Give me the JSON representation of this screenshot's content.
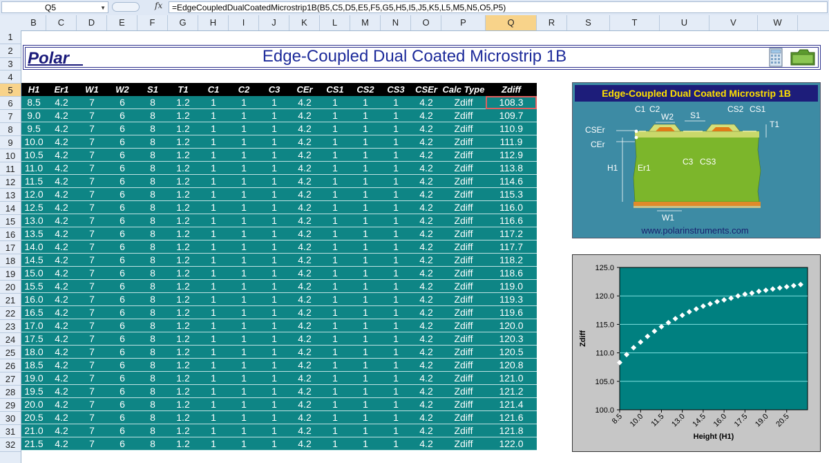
{
  "formula_bar": {
    "name_box": "Q5",
    "fx_label": "fx",
    "formula": "=EdgeCoupledDualCoatedMicrostrip1B(B5,C5,D5,E5,F5,G5,H5,I5,J5,K5,L5,M5,N5,O5,P5)"
  },
  "columns": [
    "B",
    "C",
    "D",
    "E",
    "F",
    "G",
    "H",
    "I",
    "J",
    "K",
    "L",
    "M",
    "N",
    "O",
    "P",
    "Q",
    "R",
    "S",
    "T",
    "U",
    "V",
    "W"
  ],
  "rows": [
    "1",
    "2",
    "3",
    "4",
    "5",
    "6",
    "7",
    "8",
    "9",
    "10",
    "11",
    "12",
    "13",
    "14",
    "15",
    "16",
    "17",
    "18",
    "19",
    "20",
    "21",
    "22",
    "23",
    "24",
    "25",
    "26",
    "27",
    "28",
    "29",
    "30",
    "31",
    "32"
  ],
  "title_row": {
    "logo_text": "Polar",
    "title": "Edge-Coupled Dual Coated Microstrip 1B"
  },
  "table": {
    "headers": [
      "H1",
      "Er1",
      "W1",
      "W2",
      "S1",
      "T1",
      "C1",
      "C2",
      "C3",
      "CEr",
      "CS1",
      "CS2",
      "CS3",
      "CSEr",
      "Calc Type",
      "Zdiff"
    ],
    "rows": [
      [
        "8.5",
        "4.2",
        "7",
        "6",
        "8",
        "1.2",
        "1",
        "1",
        "1",
        "4.2",
        "1",
        "1",
        "1",
        "4.2",
        "Zdiff",
        "108.3"
      ],
      [
        "9.0",
        "4.2",
        "7",
        "6",
        "8",
        "1.2",
        "1",
        "1",
        "1",
        "4.2",
        "1",
        "1",
        "1",
        "4.2",
        "Zdiff",
        "109.7"
      ],
      [
        "9.5",
        "4.2",
        "7",
        "6",
        "8",
        "1.2",
        "1",
        "1",
        "1",
        "4.2",
        "1",
        "1",
        "1",
        "4.2",
        "Zdiff",
        "110.9"
      ],
      [
        "10.0",
        "4.2",
        "7",
        "6",
        "8",
        "1.2",
        "1",
        "1",
        "1",
        "4.2",
        "1",
        "1",
        "1",
        "4.2",
        "Zdiff",
        "111.9"
      ],
      [
        "10.5",
        "4.2",
        "7",
        "6",
        "8",
        "1.2",
        "1",
        "1",
        "1",
        "4.2",
        "1",
        "1",
        "1",
        "4.2",
        "Zdiff",
        "112.9"
      ],
      [
        "11.0",
        "4.2",
        "7",
        "6",
        "8",
        "1.2",
        "1",
        "1",
        "1",
        "4.2",
        "1",
        "1",
        "1",
        "4.2",
        "Zdiff",
        "113.8"
      ],
      [
        "11.5",
        "4.2",
        "7",
        "6",
        "8",
        "1.2",
        "1",
        "1",
        "1",
        "4.2",
        "1",
        "1",
        "1",
        "4.2",
        "Zdiff",
        "114.6"
      ],
      [
        "12.0",
        "4.2",
        "7",
        "6",
        "8",
        "1.2",
        "1",
        "1",
        "1",
        "4.2",
        "1",
        "1",
        "1",
        "4.2",
        "Zdiff",
        "115.3"
      ],
      [
        "12.5",
        "4.2",
        "7",
        "6",
        "8",
        "1.2",
        "1",
        "1",
        "1",
        "4.2",
        "1",
        "1",
        "1",
        "4.2",
        "Zdiff",
        "116.0"
      ],
      [
        "13.0",
        "4.2",
        "7",
        "6",
        "8",
        "1.2",
        "1",
        "1",
        "1",
        "4.2",
        "1",
        "1",
        "1",
        "4.2",
        "Zdiff",
        "116.6"
      ],
      [
        "13.5",
        "4.2",
        "7",
        "6",
        "8",
        "1.2",
        "1",
        "1",
        "1",
        "4.2",
        "1",
        "1",
        "1",
        "4.2",
        "Zdiff",
        "117.2"
      ],
      [
        "14.0",
        "4.2",
        "7",
        "6",
        "8",
        "1.2",
        "1",
        "1",
        "1",
        "4.2",
        "1",
        "1",
        "1",
        "4.2",
        "Zdiff",
        "117.7"
      ],
      [
        "14.5",
        "4.2",
        "7",
        "6",
        "8",
        "1.2",
        "1",
        "1",
        "1",
        "4.2",
        "1",
        "1",
        "1",
        "4.2",
        "Zdiff",
        "118.2"
      ],
      [
        "15.0",
        "4.2",
        "7",
        "6",
        "8",
        "1.2",
        "1",
        "1",
        "1",
        "4.2",
        "1",
        "1",
        "1",
        "4.2",
        "Zdiff",
        "118.6"
      ],
      [
        "15.5",
        "4.2",
        "7",
        "6",
        "8",
        "1.2",
        "1",
        "1",
        "1",
        "4.2",
        "1",
        "1",
        "1",
        "4.2",
        "Zdiff",
        "119.0"
      ],
      [
        "16.0",
        "4.2",
        "7",
        "6",
        "8",
        "1.2",
        "1",
        "1",
        "1",
        "4.2",
        "1",
        "1",
        "1",
        "4.2",
        "Zdiff",
        "119.3"
      ],
      [
        "16.5",
        "4.2",
        "7",
        "6",
        "8",
        "1.2",
        "1",
        "1",
        "1",
        "4.2",
        "1",
        "1",
        "1",
        "4.2",
        "Zdiff",
        "119.6"
      ],
      [
        "17.0",
        "4.2",
        "7",
        "6",
        "8",
        "1.2",
        "1",
        "1",
        "1",
        "4.2",
        "1",
        "1",
        "1",
        "4.2",
        "Zdiff",
        "120.0"
      ],
      [
        "17.5",
        "4.2",
        "7",
        "6",
        "8",
        "1.2",
        "1",
        "1",
        "1",
        "4.2",
        "1",
        "1",
        "1",
        "4.2",
        "Zdiff",
        "120.3"
      ],
      [
        "18.0",
        "4.2",
        "7",
        "6",
        "8",
        "1.2",
        "1",
        "1",
        "1",
        "4.2",
        "1",
        "1",
        "1",
        "4.2",
        "Zdiff",
        "120.5"
      ],
      [
        "18.5",
        "4.2",
        "7",
        "6",
        "8",
        "1.2",
        "1",
        "1",
        "1",
        "4.2",
        "1",
        "1",
        "1",
        "4.2",
        "Zdiff",
        "120.8"
      ],
      [
        "19.0",
        "4.2",
        "7",
        "6",
        "8",
        "1.2",
        "1",
        "1",
        "1",
        "4.2",
        "1",
        "1",
        "1",
        "4.2",
        "Zdiff",
        "121.0"
      ],
      [
        "19.5",
        "4.2",
        "7",
        "6",
        "8",
        "1.2",
        "1",
        "1",
        "1",
        "4.2",
        "1",
        "1",
        "1",
        "4.2",
        "Zdiff",
        "121.2"
      ],
      [
        "20.0",
        "4.2",
        "7",
        "6",
        "8",
        "1.2",
        "1",
        "1",
        "1",
        "4.2",
        "1",
        "1",
        "1",
        "4.2",
        "Zdiff",
        "121.4"
      ],
      [
        "20.5",
        "4.2",
        "7",
        "6",
        "8",
        "1.2",
        "1",
        "1",
        "1",
        "4.2",
        "1",
        "1",
        "1",
        "4.2",
        "Zdiff",
        "121.6"
      ],
      [
        "21.0",
        "4.2",
        "7",
        "6",
        "8",
        "1.2",
        "1",
        "1",
        "1",
        "4.2",
        "1",
        "1",
        "1",
        "4.2",
        "Zdiff",
        "121.8"
      ],
      [
        "21.5",
        "4.2",
        "7",
        "6",
        "8",
        "1.2",
        "1",
        "1",
        "1",
        "4.2",
        "1",
        "1",
        "1",
        "4.2",
        "Zdiff",
        "122.0"
      ]
    ]
  },
  "diagram": {
    "title": "Edge-Coupled Dual Coated Microstrip 1B",
    "labels": [
      "C1",
      "C2",
      "W2",
      "S1",
      "CS2",
      "CS1",
      "T1",
      "CSEr",
      "CEr",
      "H1",
      "Er1",
      "C3",
      "CS3",
      "W1"
    ],
    "url": "www.polarinstruments.com"
  },
  "chart_data": {
    "type": "scatter",
    "title": "",
    "xlabel": "Height (H1)",
    "ylabel": "Zdiff",
    "x": [
      8.5,
      9.0,
      9.5,
      10.0,
      10.5,
      11.0,
      11.5,
      12.0,
      12.5,
      13.0,
      13.5,
      14.0,
      14.5,
      15.0,
      15.5,
      16.0,
      16.5,
      17.0,
      17.5,
      18.0,
      18.5,
      19.0,
      19.5,
      20.0,
      20.5,
      21.0,
      21.5
    ],
    "values": [
      108.3,
      109.7,
      110.9,
      111.9,
      112.9,
      113.8,
      114.6,
      115.3,
      116.0,
      116.6,
      117.2,
      117.7,
      118.2,
      118.6,
      119.0,
      119.3,
      119.6,
      120.0,
      120.3,
      120.5,
      120.8,
      121.0,
      121.2,
      121.4,
      121.6,
      121.8,
      122.0
    ],
    "xticks": [
      "8.5",
      "10.0",
      "11.5",
      "13.0",
      "14.5",
      "16.0",
      "17.5",
      "19.0",
      "20.5"
    ],
    "yticks": [
      "100.0",
      "105.0",
      "110.0",
      "115.0",
      "120.0",
      "125.0"
    ],
    "ylim": [
      100,
      125
    ],
    "grid": true,
    "legend": "none",
    "colors": {
      "plot_bg": "#008080",
      "marker": "#ffffff",
      "frame_bg": "#c6c6c6"
    }
  }
}
